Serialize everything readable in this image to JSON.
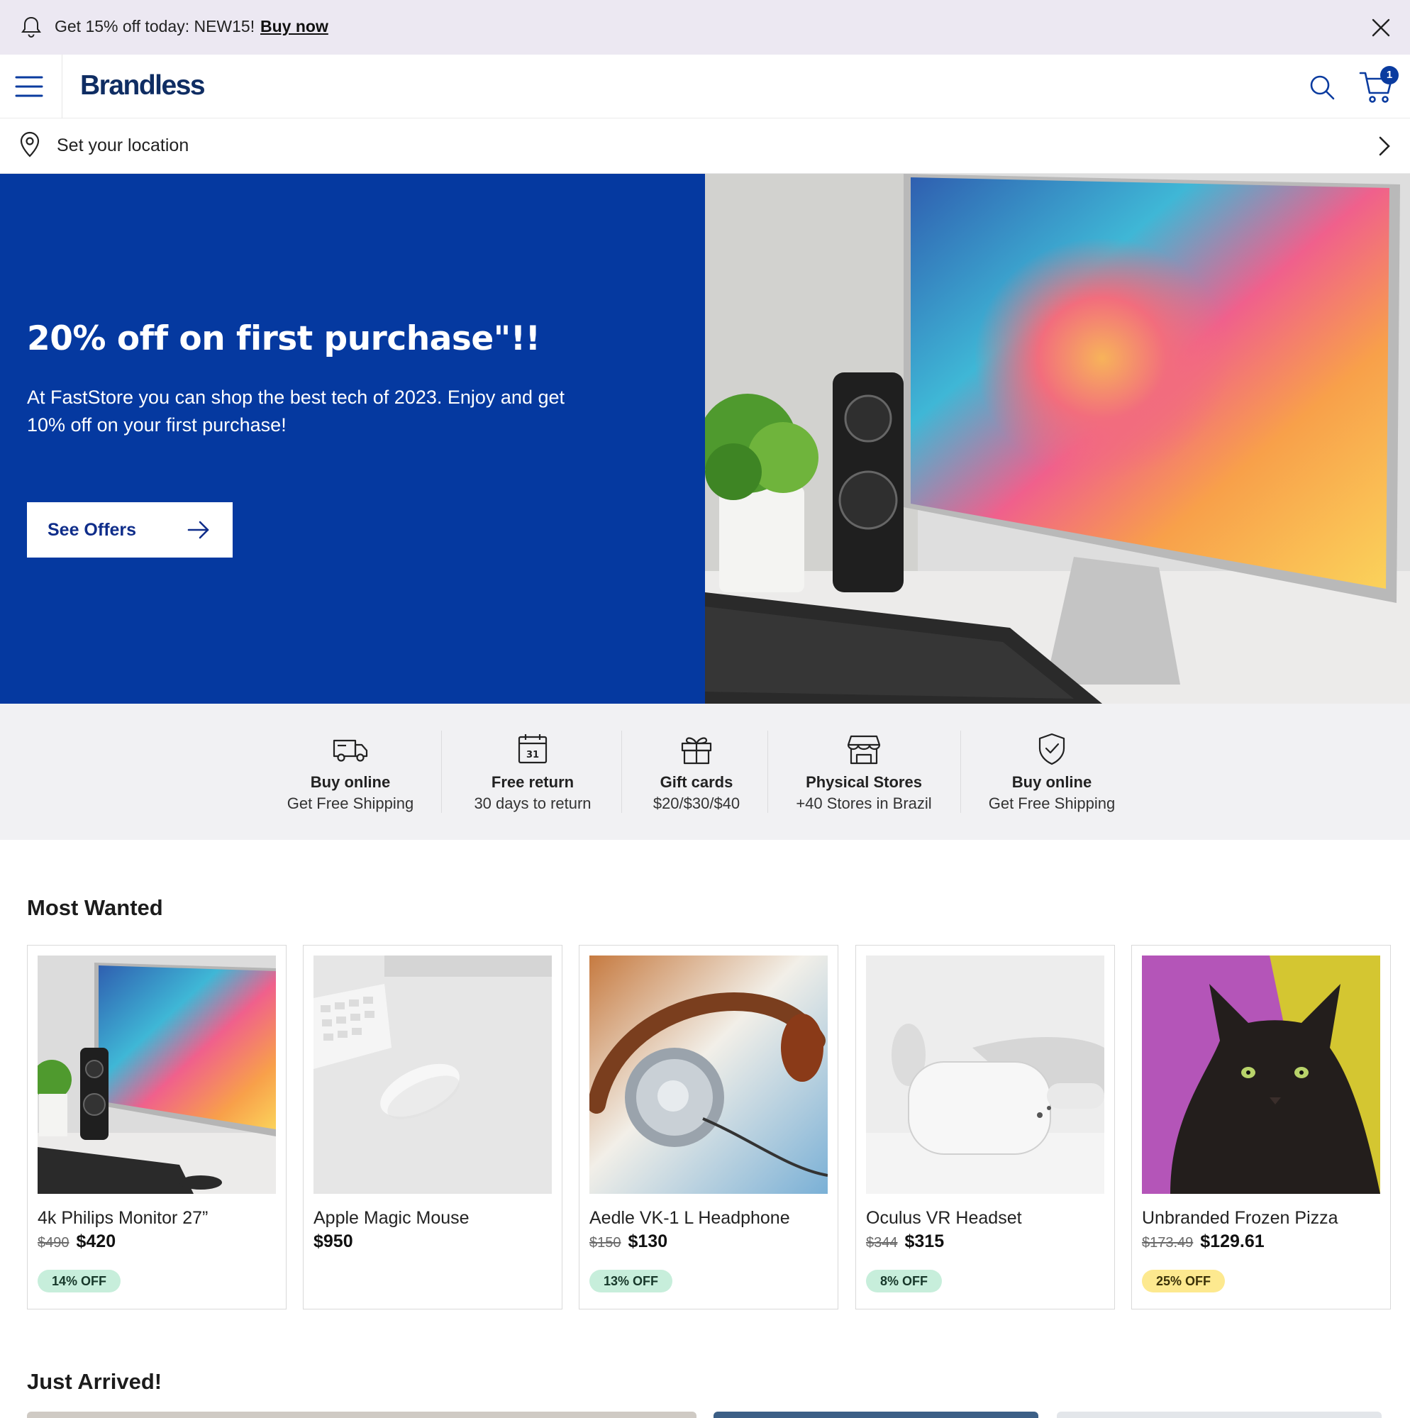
{
  "alert": {
    "message": "Get 15% off today: NEW15!",
    "link": "Buy now",
    "icon": "bell-icon",
    "close_icon": "close-icon"
  },
  "navbar": {
    "logo": "Brandless",
    "menu_icon": "hamburger-menu-icon",
    "search_icon": "search-icon",
    "cart_icon": "cart-icon",
    "cart_count": "1"
  },
  "location": {
    "label": "Set your location",
    "icon": "map-pin-icon"
  },
  "hero": {
    "title": "20% off on first purchase\"!!",
    "description": "At FastStore you can shop the best tech of 2023. Enjoy and get 10% off on your first purchase!",
    "cta": "See Offers",
    "background_color": "#0539a0"
  },
  "features": [
    {
      "title": "Buy online",
      "subtitle": "Get Free Shipping",
      "icon": "truck-icon"
    },
    {
      "title": "Free return",
      "subtitle": "30 days to return",
      "icon": "calendar-icon"
    },
    {
      "title": "Gift cards",
      "subtitle": "$20/$30/$40",
      "icon": "gift-icon"
    },
    {
      "title": "Physical Stores",
      "subtitle": "+40 Stores in Brazil",
      "icon": "storefront-icon"
    },
    {
      "title": "Buy online",
      "subtitle": "Get Free Shipping",
      "icon": "shield-check-icon"
    }
  ],
  "most_wanted": {
    "title": "Most Wanted",
    "products": [
      {
        "name": "4k Philips Monitor 27”",
        "old_price": "$490",
        "price": "$420",
        "discount": "14% OFF"
      },
      {
        "name": "Apple Magic Mouse",
        "old_price": "",
        "price": "$950",
        "discount": ""
      },
      {
        "name": "Aedle VK-1 L Headphone",
        "old_price": "$150",
        "price": "$130",
        "discount": "13% OFF"
      },
      {
        "name": "Oculus VR Headset",
        "old_price": "$344",
        "price": "$315",
        "discount": "8% OFF"
      },
      {
        "name": "Unbranded Frozen Pizza",
        "old_price": "$173.49",
        "price": "$129.61",
        "discount": "25% OFF"
      }
    ]
  },
  "just_arrived": {
    "title": "Just Arrived!"
  },
  "colors": {
    "brand_blue": "#0539a0",
    "logo_navy": "#0f2d63",
    "discount_green": "#c7eedb",
    "discount_yellow": "#fde98f"
  }
}
